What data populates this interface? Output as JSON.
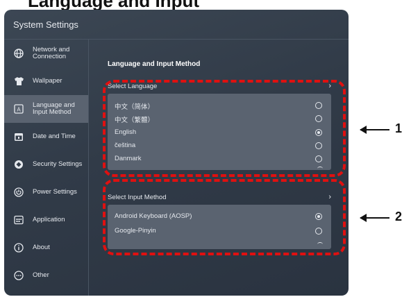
{
  "top_title": "Language and Input",
  "window": {
    "title": "System Settings"
  },
  "sidebar": {
    "items": [
      {
        "label": "Network and\nConnection",
        "icon": "globe-icon",
        "active": false
      },
      {
        "label": "Wallpaper",
        "icon": "shirt-icon",
        "active": false
      },
      {
        "label": "Language and\nInput Method",
        "icon": "language-icon",
        "active": true
      },
      {
        "label": "Date and Time",
        "icon": "calendar-icon",
        "active": false
      },
      {
        "label": "Security Settings",
        "icon": "security-icon",
        "active": false
      },
      {
        "label": "Power Settings",
        "icon": "power-icon",
        "active": false
      },
      {
        "label": "Application",
        "icon": "grid-icon",
        "active": false
      },
      {
        "label": "About",
        "icon": "info-icon",
        "active": false
      },
      {
        "label": "Other",
        "icon": "more-icon",
        "active": false
      }
    ]
  },
  "main": {
    "section_title": "Language and Input Method",
    "select_language": {
      "label": "Select Language",
      "options": [
        {
          "label": "中文（简体）",
          "checked": false
        },
        {
          "label": "中文（繁體）",
          "checked": false
        },
        {
          "label": "English",
          "checked": true
        },
        {
          "label": "čeština",
          "checked": false
        },
        {
          "label": "Danmark",
          "checked": false
        }
      ]
    },
    "select_input": {
      "label": "Select Input Method",
      "options": [
        {
          "label": "Android Keyboard (AOSP)",
          "checked": true
        },
        {
          "label": "Google-Pinyin",
          "checked": false
        }
      ]
    }
  },
  "callouts": [
    "1",
    "2"
  ],
  "colors": {
    "highlight": "#e01010",
    "panel": "#5a6370",
    "window": "#333d4a"
  }
}
